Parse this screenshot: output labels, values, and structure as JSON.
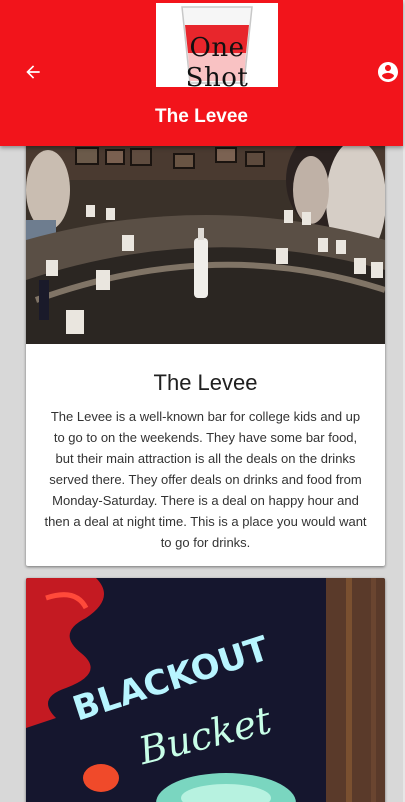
{
  "app": {
    "logo_text": "One Shot",
    "title": "The Levee"
  },
  "header_icons": {
    "back": "arrow-back-icon",
    "account": "account-circle-icon"
  },
  "colors": {
    "app_bar": "#f2141b",
    "background": "#d8d8d8",
    "card": "#ffffff"
  },
  "cards": [
    {
      "title": "The Levee",
      "description": "The Levee is a well-known bar for college kids and up to go to on the weekends. They have some bar food, but their main attraction is all the deals on the drinks served there. They offer deals on drinks and food from Monday-Saturday. There is a deal on happy hour and then a deal at night time. This is a place you would want to go for drinks."
    },
    {
      "image_text_line1": "BLACKOUT",
      "image_text_line2": "Bucket"
    }
  ]
}
